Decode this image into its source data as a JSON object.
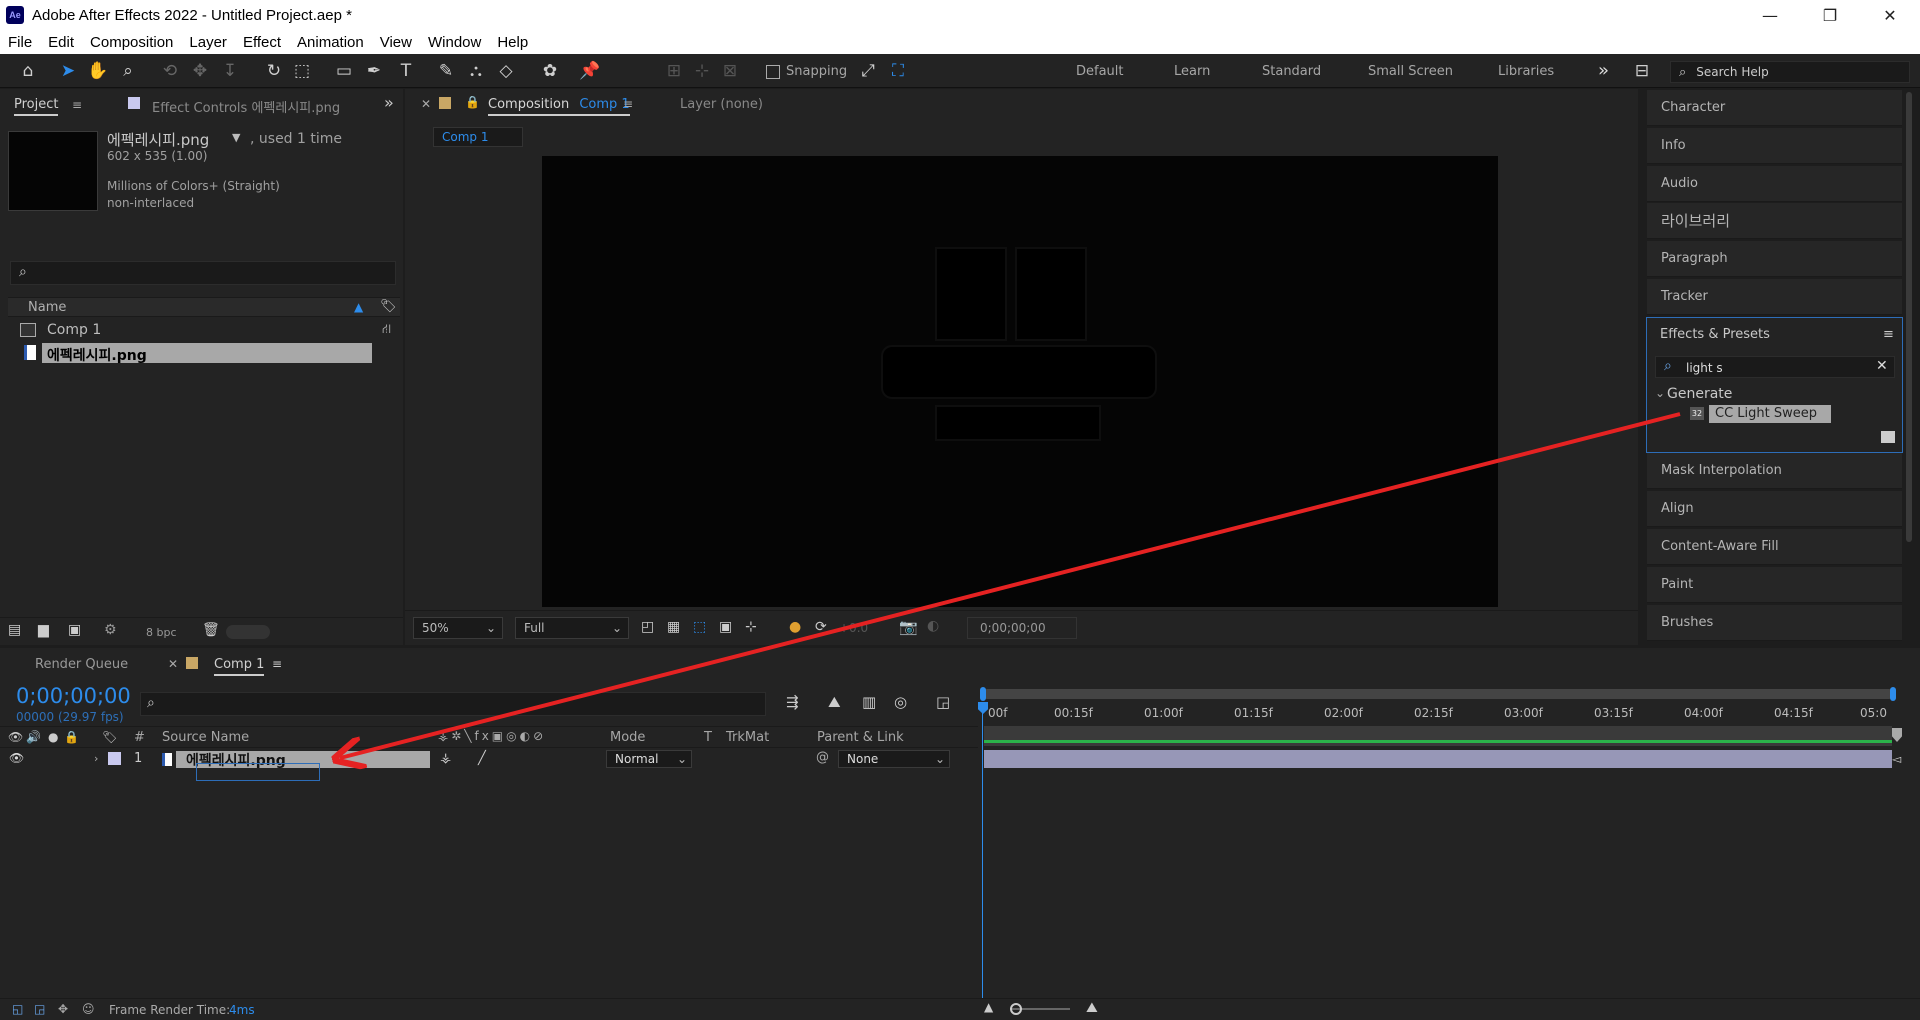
{
  "window": {
    "title": "Adobe After Effects 2022 - Untitled Project.aep *",
    "logo_text": "Ae",
    "minimize": "—",
    "maximize": "❐",
    "close": "✕"
  },
  "menu": [
    "File",
    "Edit",
    "Composition",
    "Layer",
    "Effect",
    "Animation",
    "View",
    "Window",
    "Help"
  ],
  "toolbar": {
    "snapping_label": "Snapping",
    "workspaces": [
      "Default",
      "Learn",
      "Standard",
      "Small Screen",
      "Libraries"
    ],
    "more": "»",
    "search_placeholder": "Search Help"
  },
  "project": {
    "tab_label": "Project",
    "effect_controls_label": "Effect Controls 에펙레시피.png",
    "selected_name": "에펙레시피.png",
    "used": ", used 1 time",
    "dimensions": "602 x 535 (1.00)",
    "colors": "Millions of Colors+ (Straight)",
    "interlace": "non-interlaced",
    "col_name": "Name",
    "items": [
      "Comp 1",
      "에펙레시피.png"
    ],
    "bpc": "8 bpc"
  },
  "composition": {
    "tab_prefix": "Composition",
    "comp_name": "Comp 1",
    "layer_label": "Layer (none)",
    "subtab": "Comp 1",
    "zoom": "50%",
    "resolution": "Full",
    "exposure": "+0.0",
    "timecode": "0;00;00;00"
  },
  "right_panels": {
    "top": [
      "Character",
      "Info",
      "Audio",
      "라이브러리",
      "Paragraph",
      "Tracker"
    ],
    "effects_title": "Effects & Presets",
    "effects_search": "light s",
    "category": "Generate",
    "effect_item": "CC Light Sweep",
    "effect_badge": "32",
    "bottom": [
      "Mask Interpolation",
      "Align",
      "Content-Aware Fill",
      "Paint",
      "Brushes"
    ]
  },
  "timeline": {
    "render_queue_tab": "Render Queue",
    "comp_tab": "Comp 1",
    "timecode": "0;00;00;00",
    "frame_info": "00000 (29.97 fps)",
    "col_number": "#",
    "col_source": "Source Name",
    "col_mode": "Mode",
    "col_t": "T",
    "col_trkmat": "TrkMat",
    "col_parent": "Parent & Link",
    "layer_number": "1",
    "layer_name": "에펙레시피.png",
    "layer_mode": "Normal",
    "layer_parent": "None",
    "ruler": [
      "00f",
      "00:15f",
      "01:00f",
      "01:15f",
      "02:00f",
      "02:15f",
      "03:00f",
      "03:15f",
      "04:00f",
      "04:15f",
      "05:0"
    ],
    "frame_render_label": "Frame Render Time:",
    "frame_render_value": "4ms"
  },
  "colors": {
    "accent": "#2d8ceb",
    "arrow": "#e52222",
    "bg": "#1d1d1d",
    "panel": "#232323",
    "layer_bar": "#9797b7",
    "workarea": "#2bb34a"
  },
  "annotation": "red arrow from CC Light Sweep effect to layer 에펙레시피.png"
}
